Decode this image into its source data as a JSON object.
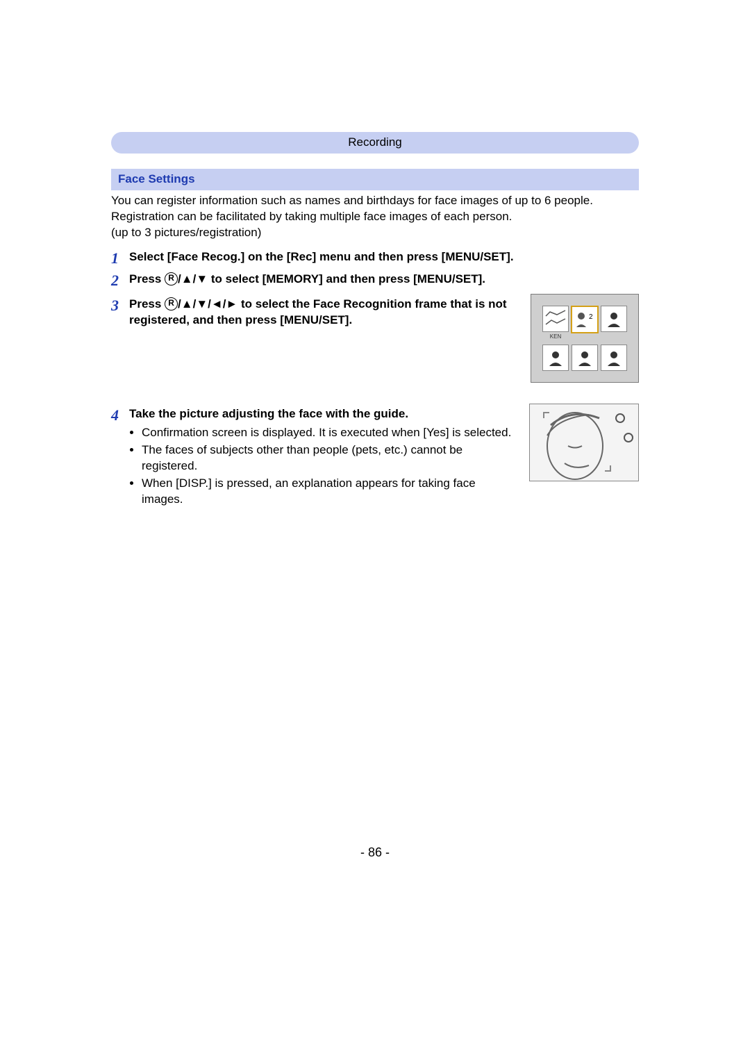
{
  "header": {
    "category": "Recording"
  },
  "section": {
    "title": "Face Settings"
  },
  "intro": [
    "You can register information such as names and birthdays for face images of up to 6 people.",
    "Registration can be facilitated by taking multiple face images of each person.",
    "(up to 3 pictures/registration)"
  ],
  "steps": {
    "s1": {
      "num": "1",
      "text": "Select [Face Recog.] on the [Rec] menu and then press [MENU/SET]."
    },
    "s2": {
      "num": "2",
      "prefix": "Press ",
      "arrows": "▲/▼",
      "suffix": " to select [MEMORY] and then press [MENU/SET]."
    },
    "s3": {
      "num": "3",
      "prefix": "Press ",
      "arrows": "▲/▼/◄/►",
      "suffix": " to select the Face Recognition frame that is not registered, and then press [MENU/SET].",
      "thumb_label": "KEN",
      "new_badge": "2"
    },
    "s4": {
      "num": "4",
      "text": "Take the picture adjusting the face with the guide.",
      "bullets": [
        "Confirmation screen is displayed. It is executed when [Yes] is selected.",
        "The faces of subjects other than people (pets, etc.) cannot be registered.",
        "When [DISP.] is pressed, an explanation appears for taking face images."
      ]
    }
  },
  "page_number": "- 86 -"
}
